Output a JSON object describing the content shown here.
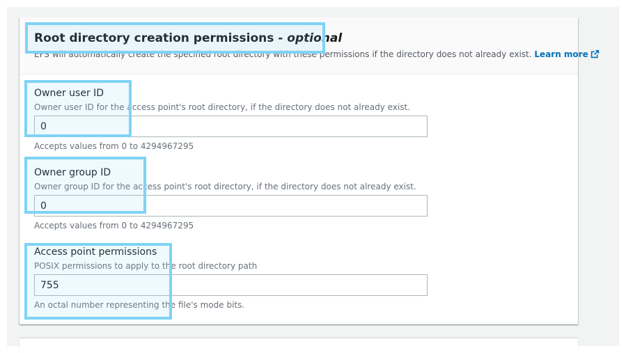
{
  "section": {
    "title": "Root directory creation permissions - ",
    "title_optional": "optional",
    "description": "EFS will automatically create the specified root directory with these permissions if the directory does not already exist.",
    "learn_more": "Learn more"
  },
  "fields": {
    "owner_uid": {
      "label": "Owner user ID",
      "description": "Owner user ID for the access point's root directory, if the directory does not already exist.",
      "value": "0",
      "hint": "Accepts values from 0 to 4294967295"
    },
    "owner_gid": {
      "label": "Owner group ID",
      "description": "Owner group ID for the access point's root directory, if the directory does not already exist.",
      "value": "0",
      "hint": "Accepts values from 0 to 4294967295"
    },
    "permissions": {
      "label": "Access point permissions",
      "description": "POSIX permissions to apply to the root directory path",
      "value": "755",
      "hint": "An octal number representing the file's mode bits."
    }
  },
  "colors": {
    "link": "#0073bb",
    "highlight": "#7fd3f5"
  },
  "icons": {
    "external_link": "external-link-icon"
  }
}
